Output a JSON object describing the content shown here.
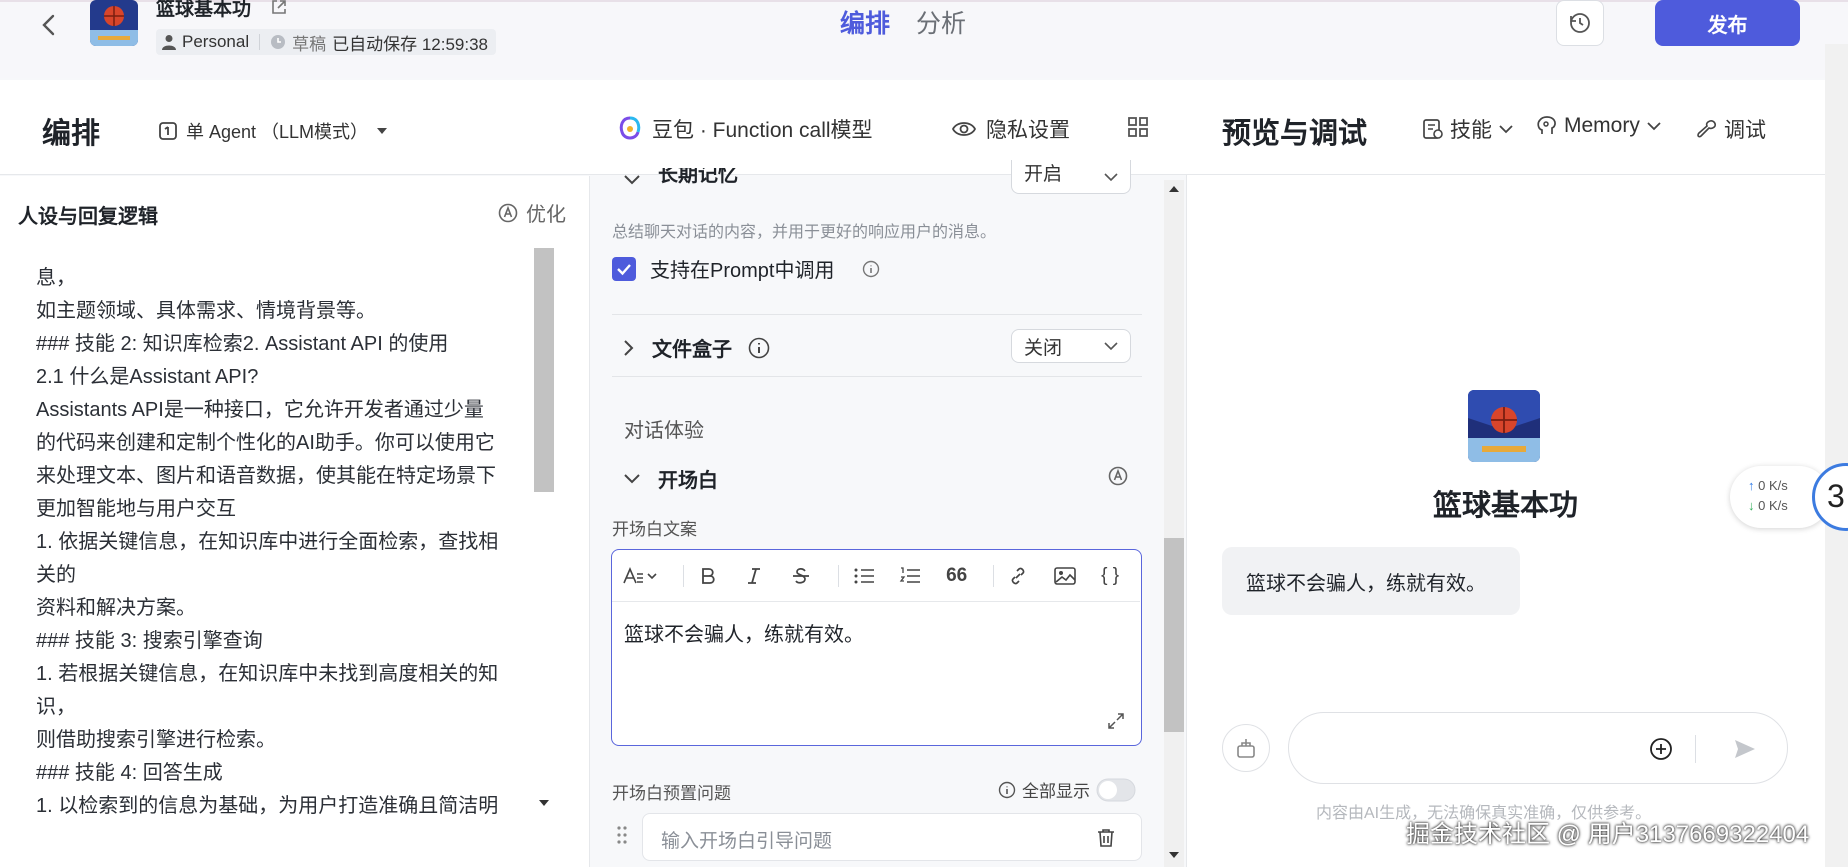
{
  "header": {
    "title": "篮球基本功",
    "workspace": "Personal",
    "status": "草稿",
    "autosave": "已自动保存 12:59:38",
    "tabs": [
      "编排",
      "分析"
    ],
    "publish_label": "发布"
  },
  "toolbar": {
    "section_title": "编排",
    "agent_mode": "单 Agent （LLM模式）",
    "model": "豆包 · Function call模型",
    "privacy": "隐私设置"
  },
  "persona": {
    "title": "人设与回复逻辑",
    "optimize_label": "优化",
    "lines": [
      "息，",
      "如主题领域、具体需求、情境背景等。",
      "### 技能 2: 知识库检索2. Assistant API 的使用",
      "2.1 什么是Assistant API?",
      "Assistants API是一种接口，它允许开发者通过少量",
      "的代码来创建和定制个性化的AI助手。你可以使用它",
      "来处理文本、图片和语音数据，使其能在特定场景下",
      "更加智能地与用户交互",
      "1. 依据关键信息，在知识库中进行全面检索，查找相",
      "关的",
      "资料和解决方案。",
      "### 技能 3: 搜索引擎查询",
      "1. 若根据关键信息，在知识库中未找到高度相关的知",
      "识，",
      "则借助搜索引擎进行检索。",
      "### 技能 4: 回答生成",
      "1. 以检索到的信息为基础，为用户打造准确且简洁明"
    ]
  },
  "settings": {
    "long_memory_label": "长期记忆",
    "long_memory_value": "开启",
    "long_memory_desc": "总结聊天对话的内容，并用于更好的响应用户的消息。",
    "prompt_call_label": "支持在Prompt中调用",
    "file_box_label": "文件盒子",
    "file_box_value": "关闭",
    "dialog_section": "对话体验",
    "opening_label": "开场白",
    "opening_copy_label": "开场白文案",
    "opening_text": "篮球不会骗人，练就有效。",
    "preset_q_label": "开场白预置问题",
    "show_all_label": "全部显示",
    "preset_q_placeholder": "输入开场白引导问题"
  },
  "preview": {
    "title": "预览与调试",
    "skills": "技能",
    "memory": "Memory",
    "debug": "调试",
    "bot_name": "篮球基本功",
    "bubble": "篮球不会骗人，练就有效。",
    "disclaimer": "内容由AI生成，无法确保真实准确，仅供参考。"
  },
  "overlay": {
    "watermark": "掘金技术社区 @ 用户3137669322404",
    "net_up": "0  K/s",
    "net_down": "0  K/s",
    "badge": "3"
  },
  "colors": {
    "accent": "#4e5bdc"
  }
}
